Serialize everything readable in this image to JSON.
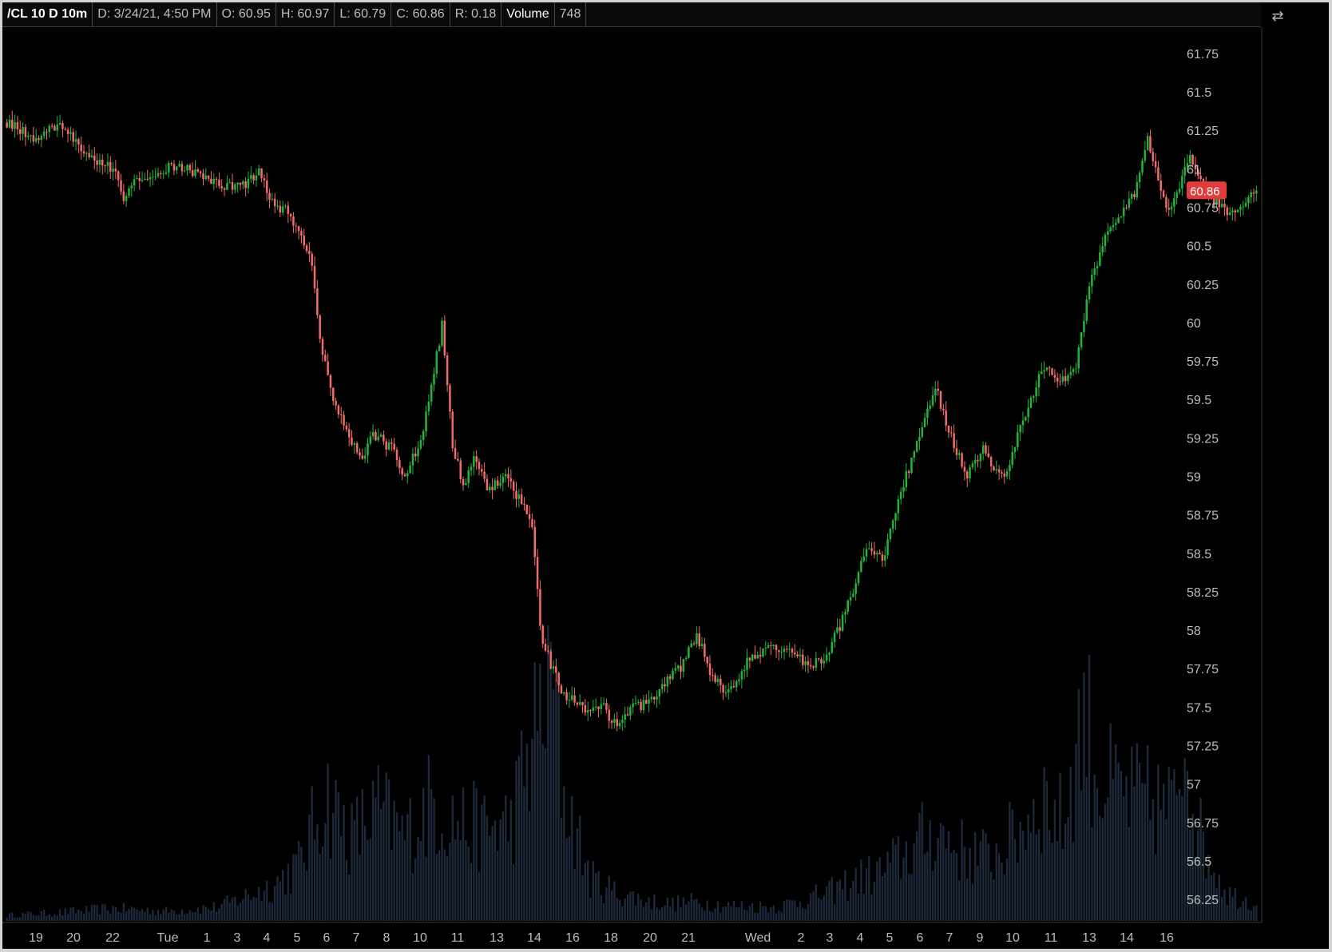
{
  "header": {
    "symbol": "/CL 10 D 10m",
    "date": "D: 3/24/21, 4:50 PM",
    "open": "O: 60.95",
    "high": "H: 60.97",
    "low": "L: 60.79",
    "close": "C: 60.86",
    "range": "R: 0.18",
    "volume_label": "Volume",
    "volume_value": "748"
  },
  "toolbar": {
    "icon": "expand-collapse-icon"
  },
  "colors": {
    "background": "#000000",
    "up": "#22b43a",
    "down": "#f26b6b",
    "volume": "#1e2a3c",
    "last_price_bg": "#e03c3c"
  },
  "chart_data": {
    "type": "candlestick",
    "title": "/CL 10 D 10m",
    "ylim": [
      56.1,
      61.9
    ],
    "y_ticks": [
      "61.75",
      "61.5",
      "61.25",
      "61",
      "60.75",
      "60.5",
      "60.25",
      "60",
      "59.75",
      "59.5",
      "59.25",
      "59",
      "58.75",
      "58.5",
      "58.25",
      "58",
      "57.75",
      "57.5",
      "57.25",
      "57",
      "56.75",
      "56.5",
      "56.25"
    ],
    "x_ticks": [
      "19",
      "20",
      "22",
      "Tue",
      "1",
      "3",
      "4",
      "5",
      "6",
      "7",
      "8",
      "10",
      "11",
      "13",
      "14",
      "16",
      "18",
      "20",
      "21",
      "Wed",
      "2",
      "3",
      "4",
      "5",
      "6",
      "7",
      "9",
      "10",
      "11",
      "13",
      "14",
      "16"
    ],
    "last_price": "60.86",
    "price_path": [
      [
        0,
        61.3
      ],
      [
        10,
        61.2
      ],
      [
        20,
        61.28
      ],
      [
        30,
        61.1
      ],
      [
        40,
        61.0
      ],
      [
        44,
        60.82
      ],
      [
        48,
        60.9
      ],
      [
        55,
        60.95
      ],
      [
        62,
        61.03
      ],
      [
        70,
        60.98
      ],
      [
        80,
        60.9
      ],
      [
        88,
        60.88
      ],
      [
        95,
        60.98
      ],
      [
        100,
        60.78
      ],
      [
        106,
        60.72
      ],
      [
        110,
        60.58
      ],
      [
        115,
        60.4
      ],
      [
        118,
        59.9
      ],
      [
        123,
        59.5
      ],
      [
        128,
        59.3
      ],
      [
        134,
        59.12
      ],
      [
        138,
        59.28
      ],
      [
        145,
        59.18
      ],
      [
        150,
        58.98
      ],
      [
        157,
        59.3
      ],
      [
        164,
        59.98
      ],
      [
        168,
        59.2
      ],
      [
        172,
        58.95
      ],
      [
        176,
        59.1
      ],
      [
        182,
        58.9
      ],
      [
        188,
        59.02
      ],
      [
        194,
        58.82
      ],
      [
        198,
        58.7
      ],
      [
        201,
        58.0
      ],
      [
        205,
        57.78
      ],
      [
        210,
        57.58
      ],
      [
        218,
        57.48
      ],
      [
        225,
        57.5
      ],
      [
        230,
        57.36
      ],
      [
        236,
        57.5
      ],
      [
        242,
        57.52
      ],
      [
        248,
        57.65
      ],
      [
        255,
        57.78
      ],
      [
        260,
        57.98
      ],
      [
        266,
        57.68
      ],
      [
        272,
        57.6
      ],
      [
        280,
        57.82
      ],
      [
        288,
        57.9
      ],
      [
        296,
        57.88
      ],
      [
        302,
        57.76
      ],
      [
        308,
        57.82
      ],
      [
        314,
        58.02
      ],
      [
        318,
        58.22
      ],
      [
        324,
        58.52
      ],
      [
        330,
        58.45
      ],
      [
        336,
        58.85
      ],
      [
        340,
        59.05
      ],
      [
        345,
        59.3
      ],
      [
        350,
        59.58
      ],
      [
        356,
        59.25
      ],
      [
        362,
        59.0
      ],
      [
        368,
        59.2
      ],
      [
        372,
        59.05
      ],
      [
        376,
        58.98
      ],
      [
        382,
        59.32
      ],
      [
        387,
        59.55
      ],
      [
        391,
        59.72
      ],
      [
        398,
        59.62
      ],
      [
        403,
        59.72
      ],
      [
        408,
        60.25
      ],
      [
        414,
        60.55
      ],
      [
        420,
        60.68
      ],
      [
        426,
        60.88
      ],
      [
        430,
        61.2
      ],
      [
        434,
        60.9
      ],
      [
        438,
        60.72
      ],
      [
        442,
        60.86
      ],
      [
        446,
        61.1
      ],
      [
        450,
        60.9
      ],
      [
        455,
        60.8
      ],
      [
        460,
        60.72
      ],
      [
        466,
        60.76
      ],
      [
        471,
        60.86
      ]
    ],
    "volume_path": [
      [
        0,
        40
      ],
      [
        20,
        60
      ],
      [
        40,
        90
      ],
      [
        60,
        70
      ],
      [
        80,
        100
      ],
      [
        100,
        250
      ],
      [
        110,
        400
      ],
      [
        120,
        900
      ],
      [
        130,
        600
      ],
      [
        140,
        800
      ],
      [
        150,
        600
      ],
      [
        160,
        850
      ],
      [
        170,
        700
      ],
      [
        180,
        650
      ],
      [
        190,
        700
      ],
      [
        200,
        1400
      ],
      [
        205,
        1800
      ],
      [
        210,
        900
      ],
      [
        220,
        300
      ],
      [
        230,
        200
      ],
      [
        240,
        150
      ],
      [
        250,
        120
      ],
      [
        260,
        140
      ],
      [
        270,
        110
      ],
      [
        290,
        100
      ],
      [
        310,
        200
      ],
      [
        320,
        300
      ],
      [
        330,
        350
      ],
      [
        340,
        500
      ],
      [
        350,
        650
      ],
      [
        360,
        500
      ],
      [
        370,
        450
      ],
      [
        380,
        600
      ],
      [
        390,
        900
      ],
      [
        398,
        700
      ],
      [
        406,
        1500
      ],
      [
        412,
        1000
      ],
      [
        420,
        900
      ],
      [
        430,
        850
      ],
      [
        440,
        800
      ],
      [
        444,
        1400
      ],
      [
        450,
        600
      ],
      [
        460,
        200
      ],
      [
        471,
        120
      ]
    ],
    "volume_max": 1900,
    "bars": 472
  }
}
